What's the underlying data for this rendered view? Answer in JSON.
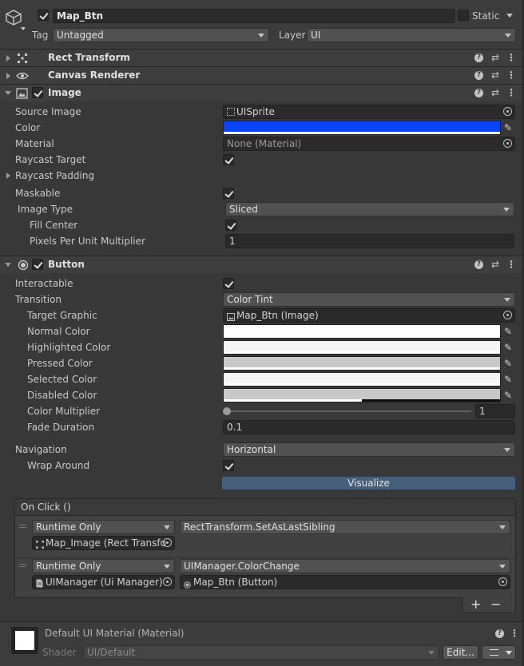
{
  "gameobject": {
    "name": "Map_Btn",
    "static_label": "Static",
    "tag_label": "Tag",
    "tag_value": "Untagged",
    "layer_label": "Layer",
    "layer_value": "UI"
  },
  "components": {
    "rect_transform": "Rect Transform",
    "canvas_renderer": "Canvas Renderer",
    "image": "Image",
    "button": "Button"
  },
  "image": {
    "source_image_label": "Source Image",
    "source_image_value": "UISprite",
    "color_label": "Color",
    "color_value": "#0a44ff",
    "material_label": "Material",
    "material_value": "None (Material)",
    "raycast_target_label": "Raycast Target",
    "raycast_padding_label": "Raycast Padding",
    "maskable_label": "Maskable",
    "image_type_label": "Image Type",
    "image_type_value": "Sliced",
    "fill_center_label": "Fill Center",
    "ppu_label": "Pixels Per Unit Multiplier",
    "ppu_value": "1"
  },
  "button": {
    "interactable_label": "Interactable",
    "transition_label": "Transition",
    "transition_value": "Color Tint",
    "target_graphic_label": "Target Graphic",
    "target_graphic_value": "Map_Btn (Image)",
    "normal_color_label": "Normal Color",
    "highlighted_color_label": "Highlighted Color",
    "pressed_color_label": "Pressed Color",
    "selected_color_label": "Selected Color",
    "disabled_color_label": "Disabled Color",
    "color_multiplier_label": "Color Multiplier",
    "color_multiplier_value": "1",
    "fade_duration_label": "Fade Duration",
    "fade_duration_value": "0.1",
    "navigation_label": "Navigation",
    "navigation_value": "Horizontal",
    "wrap_around_label": "Wrap Around",
    "visualize_label": "Visualize"
  },
  "onclick": {
    "title": "On Click ()",
    "entries": [
      {
        "runtime": "Runtime Only",
        "function": "RectTransform.SetAsLastSibling",
        "target": "Map_Image (Rect Transfo"
      },
      {
        "runtime": "Runtime Only",
        "function": "UIManager.ColorChange",
        "target": "UIManager (Ui Manager)",
        "argument": "Map_Btn (Button)"
      }
    ],
    "add_label": "+",
    "remove_label": "−"
  },
  "material": {
    "name": "Default UI Material (Material)",
    "shader_label": "Shader",
    "shader_value": "UI/Default",
    "edit_label": "Edit..."
  }
}
